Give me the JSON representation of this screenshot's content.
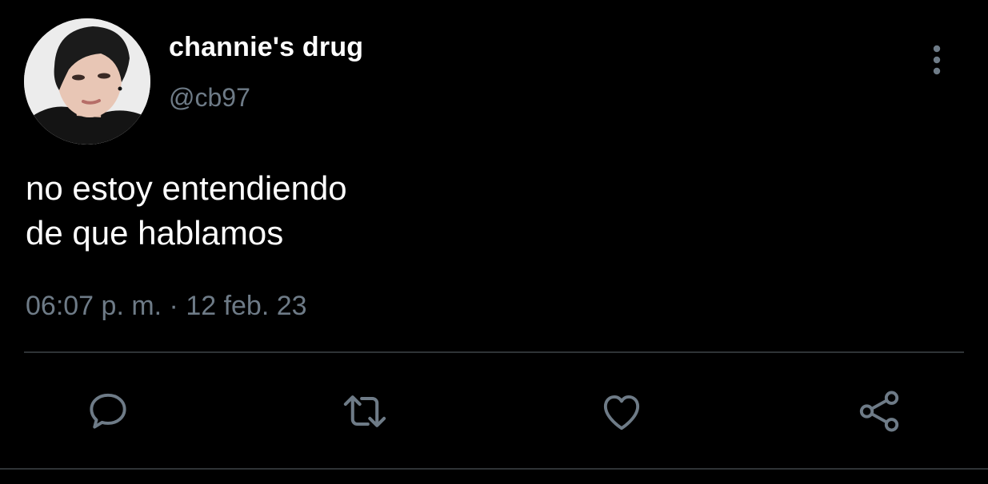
{
  "tweet": {
    "display_name": "channie's drug",
    "handle": "@cb97",
    "text_lines": [
      "no estoy entendiendo",
      "de que hablamos"
    ],
    "timestamp": "06:07 p. m. · 12 feb. 23"
  },
  "icons": {
    "more": "more-vertical-icon",
    "reply": "reply-icon",
    "retweet": "retweet-icon",
    "like": "heart-icon",
    "share": "share-icon"
  },
  "colors": {
    "background": "#000000",
    "text": "#ffffff",
    "secondary": "#6e7b87",
    "divider": "#2f3336"
  }
}
